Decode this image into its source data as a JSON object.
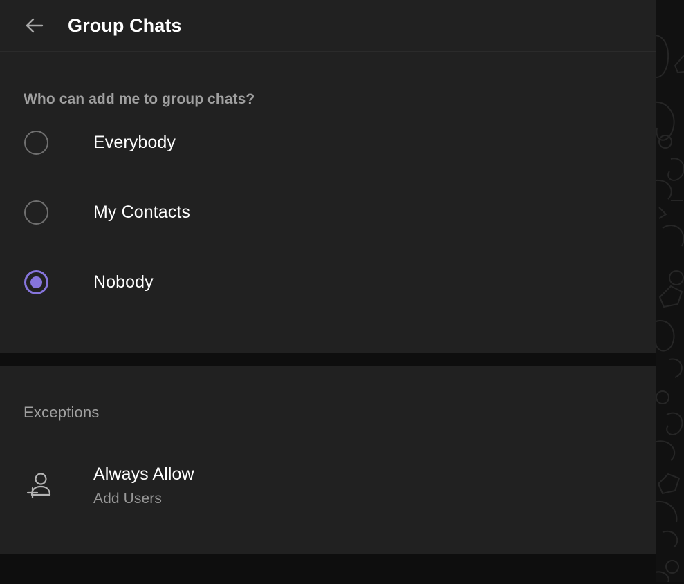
{
  "header": {
    "back_icon": "arrow-left-icon",
    "title": "Group Chats"
  },
  "privacy_section": {
    "heading": "Who can add me to group chats?",
    "options": [
      {
        "label": "Everybody",
        "selected": false
      },
      {
        "label": "My Contacts",
        "selected": false
      },
      {
        "label": "Nobody",
        "selected": true
      }
    ]
  },
  "exceptions_section": {
    "heading": "Exceptions",
    "rows": [
      {
        "icon": "add-user-icon",
        "title": "Always Allow",
        "subtitle": "Add Users"
      }
    ]
  },
  "colors": {
    "accent": "#8675dc",
    "panel_bg": "#212121",
    "page_bg": "#0e0e0e",
    "primary_text": "#ffffff",
    "secondary_text": "#a0a0a0",
    "radio_unselected": "#6f6f6f"
  }
}
